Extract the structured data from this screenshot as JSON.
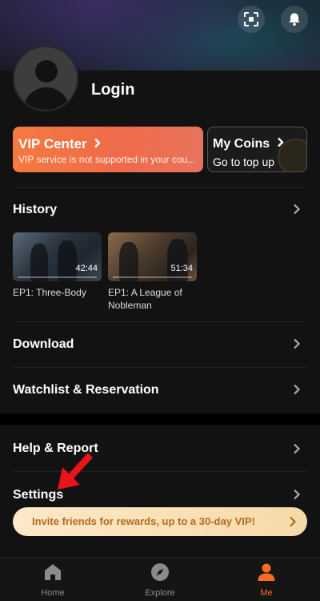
{
  "header": {
    "scan_icon": "scan-icon",
    "bell_icon": "bell-icon"
  },
  "profile": {
    "login_label": "Login"
  },
  "vip_card": {
    "title": "VIP Center",
    "subtitle": "VIP service is not supported in your cou..."
  },
  "coins_card": {
    "title": "My Coins",
    "subtitle": "Go to top up"
  },
  "history": {
    "label": "History",
    "items": [
      {
        "title": "EP1: Three-Body",
        "duration": "42:44"
      },
      {
        "title": "EP1: A League of Nobleman",
        "duration": "51:34"
      }
    ]
  },
  "menu": {
    "download": "Download",
    "watchlist": "Watchlist & Reservation",
    "help": "Help & Report",
    "settings": "Settings"
  },
  "invite_banner": {
    "text": "Invite friends for rewards, up to a 30-day VIP!"
  },
  "tabbar": {
    "tabs": [
      {
        "label": "Home"
      },
      {
        "label": "Explore"
      },
      {
        "label": "Me"
      }
    ],
    "active_color": "#ff6a1f"
  },
  "colors": {
    "vip_gradient_start": "#f47a3f",
    "invite_text": "#b56a1e",
    "annotation_arrow": "#e8141b"
  }
}
